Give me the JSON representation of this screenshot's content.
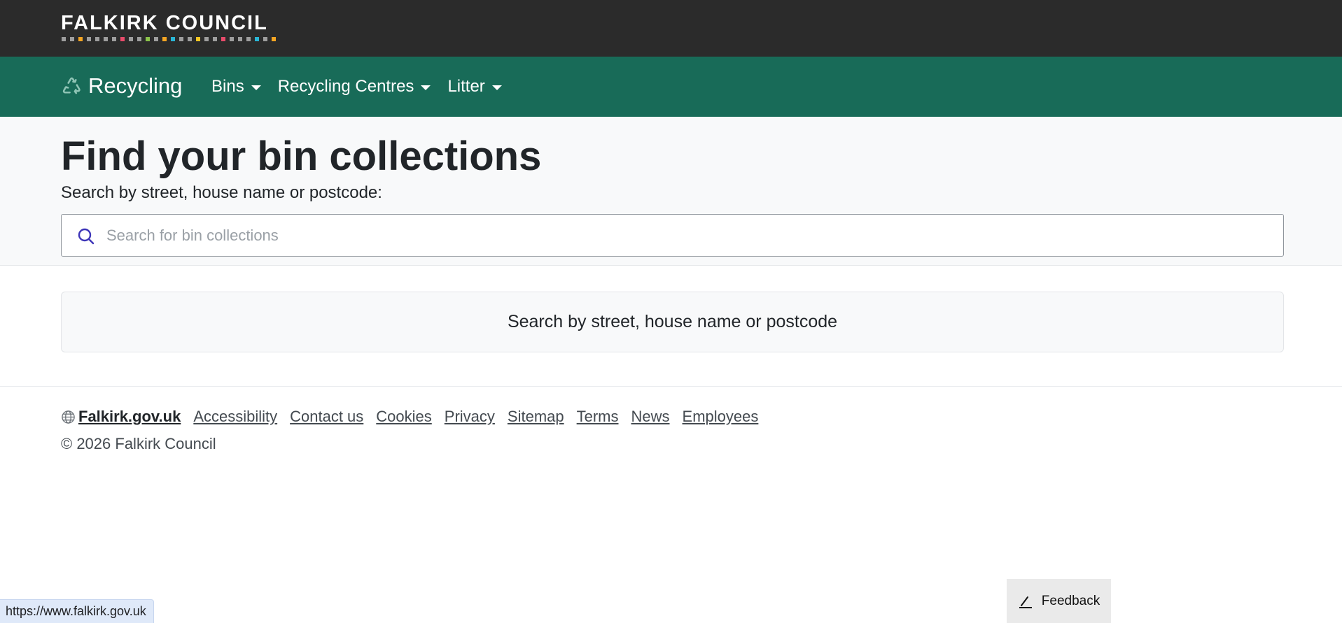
{
  "header": {
    "logo_text": "FALKIRK COUNCIL",
    "logo_dot_colors": [
      "#9e9e9e",
      "#9e9e9e",
      "#f5a623",
      "#9e9e9e",
      "#9e9e9e",
      "#9e9e9e",
      "#9e9e9e",
      "#e94b6b",
      "#9e9e9e",
      "#9e9e9e",
      "#8bc34a",
      "#9e9e9e",
      "#f5a623",
      "#29b6d6",
      "#9e9e9e",
      "#9e9e9e",
      "#f5c623",
      "#9e9e9e",
      "#9e9e9e",
      "#e94b6b",
      "#9e9e9e",
      "#9e9e9e",
      "#9e9e9e",
      "#29b6d6",
      "#9e9e9e",
      "#f5a623"
    ],
    "background": "#2b2b2b"
  },
  "navbar": {
    "brand_label": "Recycling",
    "brand_icon": "recycle-icon",
    "background": "#186b58",
    "items": [
      {
        "label": "Bins",
        "icon": "caret-down-icon"
      },
      {
        "label": "Recycling Centres",
        "icon": "caret-down-icon"
      },
      {
        "label": "Litter",
        "icon": "caret-down-icon"
      }
    ]
  },
  "hero": {
    "title": "Find your bin collections",
    "search_label": "Search by street, house name or postcode:",
    "search_placeholder": "Search for bin collections",
    "search_value": "",
    "search_icon": "search-icon"
  },
  "results": {
    "message": "Search by street, house name or postcode"
  },
  "footer": {
    "home_link": "Falkirk.gov.uk",
    "home_icon": "globe-icon",
    "links": [
      "Accessibility",
      "Contact us",
      "Cookies",
      "Privacy",
      "Sitemap",
      "Terms",
      "News",
      "Employees"
    ],
    "copyright": "© 2026 Falkirk Council"
  },
  "feedback": {
    "label": "Feedback",
    "icon": "pencil-icon"
  },
  "status_bar": {
    "url": "https://www.falkirk.gov.uk"
  }
}
